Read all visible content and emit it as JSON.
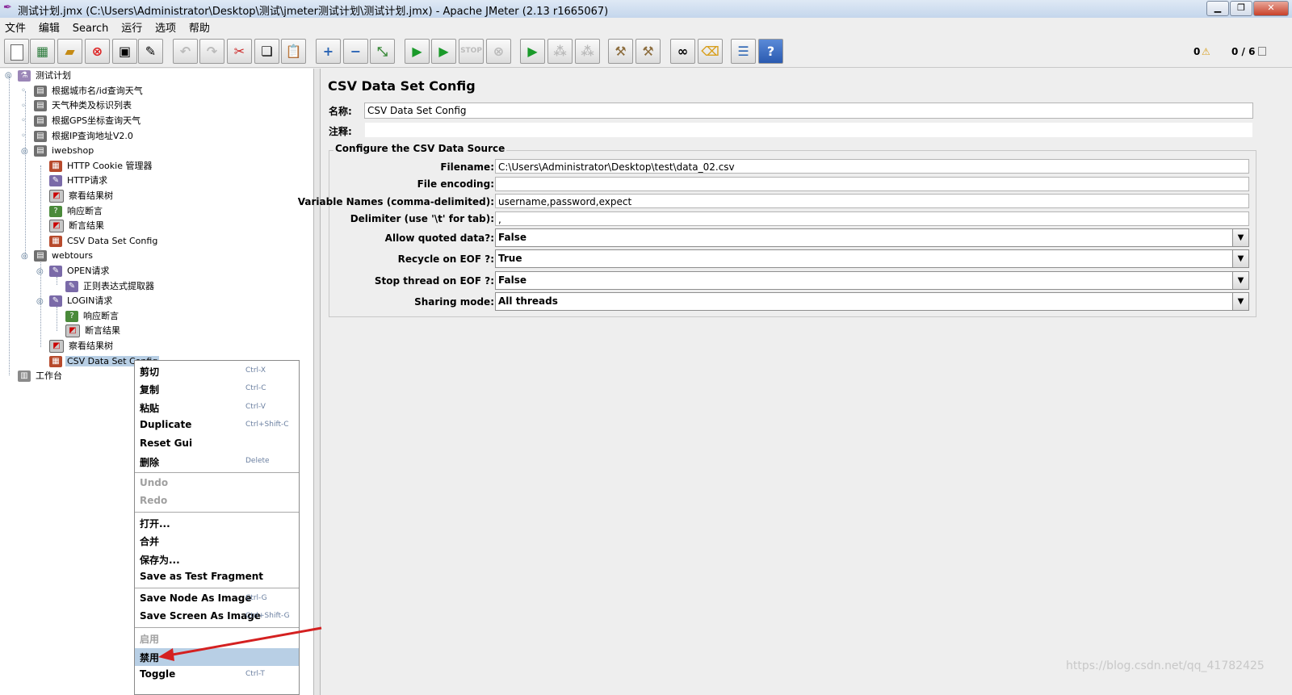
{
  "window": {
    "title": "测试计划.jmx (C:\\Users\\Administrator\\Desktop\\测试\\jmeter测试计划\\测试计划.jmx) - Apache JMeter (2.13 r1665067)"
  },
  "menu": [
    "文件",
    "编辑",
    "Search",
    "运行",
    "选项",
    "帮助"
  ],
  "toolbar": {
    "buttons": [
      "new-icon",
      "templates-icon",
      "open-icon",
      "close-icon",
      "save-icon",
      "save-as-icon",
      "undo-icon",
      "redo-icon",
      "cut-icon",
      "copy-icon",
      "paste-icon",
      "expand-icon",
      "collapse-icon",
      "toggle-icon",
      "start-icon",
      "start-no-pause-icon",
      "stop-icon",
      "shutdown-icon",
      "remote-start-icon",
      "remote-stop-icon",
      "remote-shutdown-icon",
      "clear-icon",
      "clear-all-icon",
      "search-icon",
      "reset-search-icon",
      "function-helper-icon",
      "help-icon"
    ],
    "warnings": "0",
    "threads": "0 / 6"
  },
  "tree": {
    "nodes": [
      {
        "label": "测试计划",
        "icon": "test-plan-icon"
      },
      {
        "label": "根据城市名/id查询天气",
        "icon": "thread-group-icon"
      },
      {
        "label": "天气种类及标识列表",
        "icon": "thread-group-icon"
      },
      {
        "label": "根据GPS坐标查询天气",
        "icon": "thread-group-icon"
      },
      {
        "label": "根据IP查询地址V2.0",
        "icon": "thread-group-icon"
      },
      {
        "label": "iwebshop",
        "icon": "thread-group-icon"
      },
      {
        "label": "HTTP Cookie 管理器",
        "icon": "config-element-icon"
      },
      {
        "label": "HTTP请求",
        "icon": "http-sampler-icon"
      },
      {
        "label": "察看结果树",
        "icon": "listener-icon"
      },
      {
        "label": "响应断言",
        "icon": "assertion-icon"
      },
      {
        "label": "断言结果",
        "icon": "listener-icon"
      },
      {
        "label": "CSV Data Set Config",
        "icon": "config-element-icon"
      },
      {
        "label": "webtours",
        "icon": "thread-group-icon"
      },
      {
        "label": "OPEN请求",
        "icon": "http-sampler-icon"
      },
      {
        "label": "正则表达式提取器",
        "icon": "post-processor-icon"
      },
      {
        "label": "LOGIN请求",
        "icon": "http-sampler-icon"
      },
      {
        "label": "响应断言",
        "icon": "assertion-icon"
      },
      {
        "label": "断言结果",
        "icon": "listener-icon"
      },
      {
        "label": "察看结果树",
        "icon": "listener-icon"
      },
      {
        "label": "CSV Data Set Config",
        "icon": "config-element-icon"
      },
      {
        "label": "工作台",
        "icon": "workbench-icon"
      }
    ]
  },
  "panel": {
    "title": "CSV Data Set Config",
    "name_label": "名称:",
    "name_value": "CSV Data Set Config",
    "comment_label": "注释:",
    "comment_value": "",
    "section_title": "Configure the CSV Data Source",
    "filename_label": "Filename:",
    "filename_value": "C:\\Users\\Administrator\\Desktop\\test\\data_02.csv",
    "encoding_label": "File encoding:",
    "encoding_value": "",
    "varnames_label": "Variable Names (comma-delimited):",
    "varnames_value": "username,password,expect",
    "delimiter_label": "Delimiter (use '\\t' for tab):",
    "delimiter_value": ",",
    "quoted_label": "Allow quoted data?:",
    "quoted_value": "False",
    "recycle_label": "Recycle on EOF ?:",
    "recycle_value": "True",
    "stop_label": "Stop thread on EOF ?:",
    "stop_value": "False",
    "sharing_label": "Sharing mode:",
    "sharing_value": "All threads"
  },
  "context_menu": {
    "cut": {
      "label": "剪切",
      "shortcut": "Ctrl-X"
    },
    "copy": {
      "label": "复制",
      "shortcut": "Ctrl-C"
    },
    "paste": {
      "label": "粘贴",
      "shortcut": "Ctrl-V"
    },
    "duplicate": {
      "label": "Duplicate",
      "shortcut": "Ctrl+Shift-C"
    },
    "reset_gui": {
      "label": "Reset Gui"
    },
    "delete": {
      "label": "删除",
      "shortcut": "Delete"
    },
    "undo": {
      "label": "Undo"
    },
    "redo": {
      "label": "Redo"
    },
    "open": {
      "label": "打开..."
    },
    "merge": {
      "label": "合并"
    },
    "save_as": {
      "label": "保存为..."
    },
    "save_fragment": {
      "label": "Save as Test Fragment"
    },
    "save_node_image": {
      "label": "Save Node As Image",
      "shortcut": "Ctrl-G"
    },
    "save_screen_image": {
      "label": "Save Screen As Image",
      "shortcut": "Ctrl+Shift-G"
    },
    "enable": {
      "label": "启用"
    },
    "disable": {
      "label": "禁用"
    },
    "toggle": {
      "label": "Toggle",
      "shortcut": "Ctrl-T"
    }
  },
  "watermark": "https://blog.csdn.net/qq_41782425",
  "colors": {
    "selection": "#b8cfe5",
    "arrow": "#d42020",
    "title_bar": "#c4d6ec"
  }
}
